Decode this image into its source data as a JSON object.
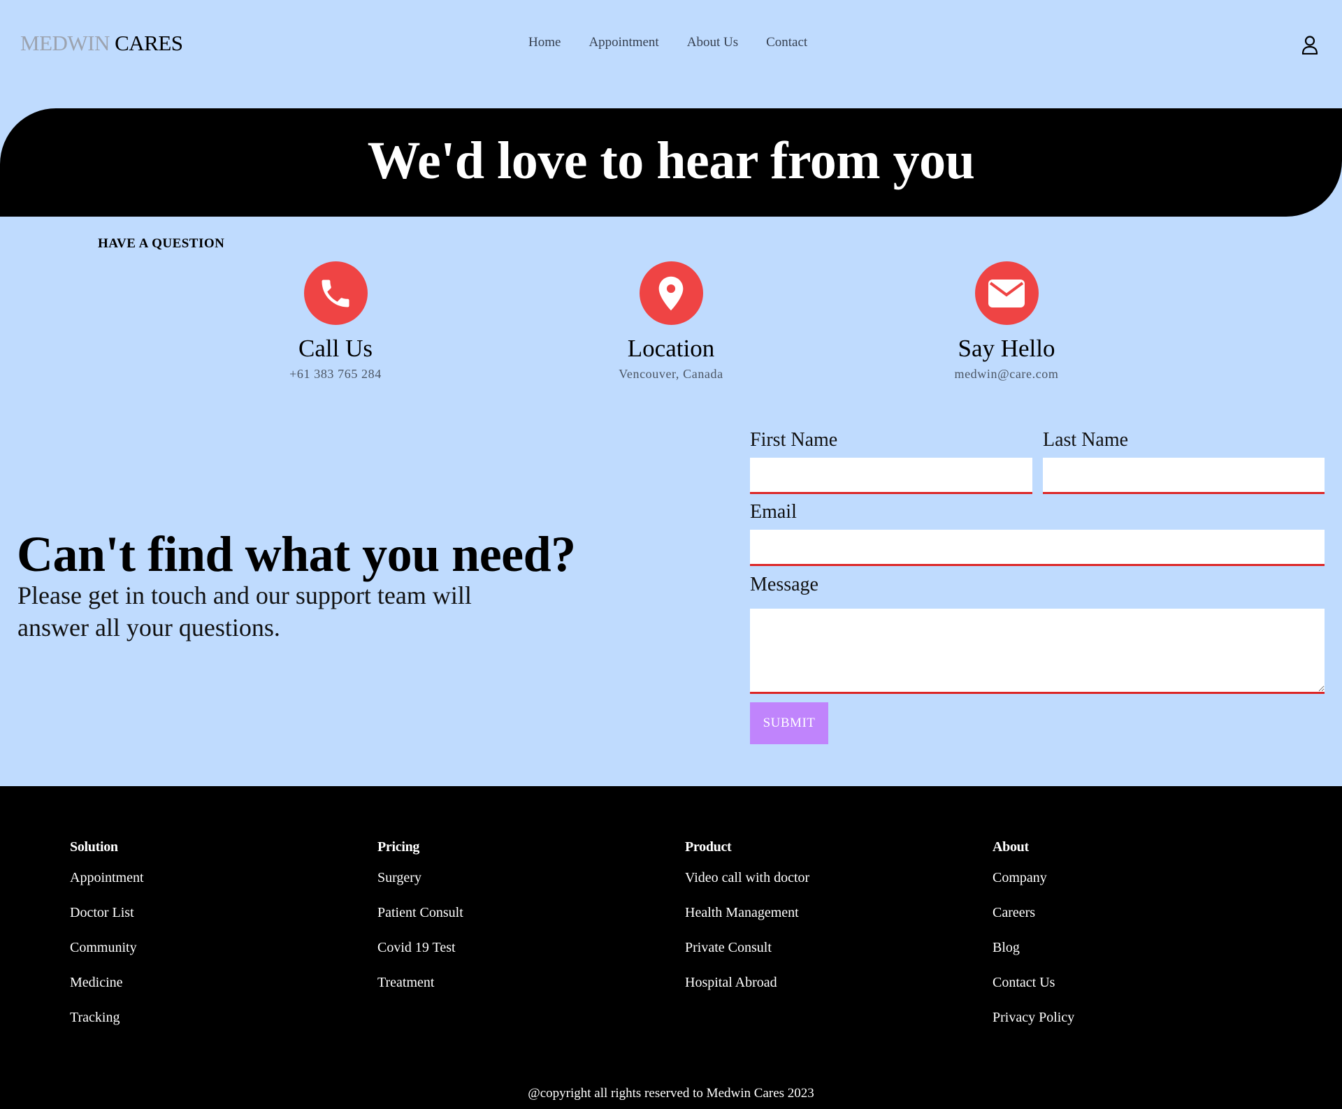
{
  "header": {
    "logo_part1": "MEDWIN",
    "logo_part2": "CARES",
    "nav": [
      "Home",
      "Appointment",
      "About Us",
      "Contact"
    ]
  },
  "banner": {
    "title": "We'd love to hear from you"
  },
  "question_label": "HAVE A QUESTION",
  "contacts": [
    {
      "title": "Call Us",
      "sub": "+61 383 765 284",
      "icon": "phone-icon"
    },
    {
      "title": "Location",
      "sub": "Vencouver, Canada",
      "icon": "location-pin-icon"
    },
    {
      "title": "Say Hello",
      "sub": "medwin@care.com",
      "icon": "envelope-icon"
    }
  ],
  "help": {
    "heading": "Can't find what you need?",
    "description": "Please get in touch and our support team will answer all your questions."
  },
  "form": {
    "first_name_label": "First Name",
    "last_name_label": "Last Name",
    "email_label": "Email",
    "message_label": "Message",
    "first_name_value": "",
    "last_name_value": "",
    "email_value": "",
    "message_value": "",
    "submit_label": "SUBMIT"
  },
  "footer": {
    "columns": [
      {
        "title": "Solution",
        "links": [
          "Appointment",
          "Doctor List",
          "Community",
          "Medicine",
          "Tracking"
        ]
      },
      {
        "title": "Pricing",
        "links": [
          "Surgery",
          "Patient Consult",
          "Covid 19 Test",
          "Treatment"
        ]
      },
      {
        "title": "Product",
        "links": [
          "Video call with doctor",
          "Health Management",
          "Private Consult",
          "Hospital Abroad"
        ]
      },
      {
        "title": "About",
        "links": [
          "Company",
          "Careers",
          "Blog",
          "Contact Us",
          "Privacy Policy"
        ]
      }
    ],
    "copyright": "@copyright all rights reserved to Medwin Cares 2023"
  },
  "colors": {
    "background": "#bfdbfe",
    "accent_red": "#ef4444",
    "input_underline": "#dc2626",
    "submit": "#c084fc",
    "dark": "#000000"
  }
}
